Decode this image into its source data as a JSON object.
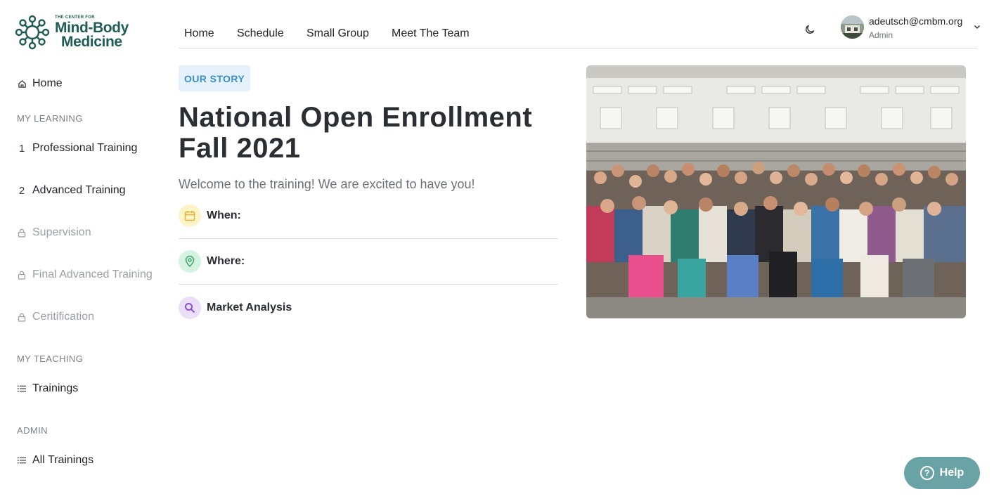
{
  "logo": {
    "tagline": "THE CENTER FOR",
    "line1": "Mind-Body",
    "line2": "Medicine",
    "brand_color": "#1f5c55"
  },
  "sidebar": {
    "home": {
      "icon": "home-icon",
      "label": "Home"
    },
    "my_learning_heading": "MY LEARNING",
    "learning_items": [
      {
        "icon_text": "1",
        "label": "Professional Training",
        "locked": false
      },
      {
        "icon_text": "2",
        "label": "Advanced Training",
        "locked": false
      },
      {
        "icon": "lock-icon",
        "label": "Supervision",
        "locked": true
      },
      {
        "icon": "lock-icon",
        "label": "Final Advanced Training",
        "locked": true
      },
      {
        "icon": "lock-icon",
        "label": "Ceritification",
        "locked": true
      }
    ],
    "my_teaching_heading": "MY TEACHING",
    "teaching_items": [
      {
        "icon": "list-icon",
        "label": "Trainings"
      }
    ],
    "admin_heading": "ADMIN",
    "admin_items": [
      {
        "icon": "list-icon",
        "label": "All Trainings"
      }
    ]
  },
  "topnav": {
    "links": [
      "Home",
      "Schedule",
      "Small Group",
      "Meet The Team"
    ],
    "theme_toggle_icon": "moon-icon",
    "user": {
      "email": "adeutsch@cmbm.org",
      "role": "Admin"
    }
  },
  "main": {
    "badge": "OUR STORY",
    "title": "National Open Enrollment Fall 2021",
    "welcome": "Welcome to the training! We are excited to have you!",
    "info_rows": [
      {
        "icon": "calendar-icon",
        "label": "When:",
        "color": "#e0b43a",
        "bg": "#fdf4c8"
      },
      {
        "icon": "map-pin-icon",
        "label": "Where:",
        "color": "#3aa56a",
        "bg": "#d6f2e1"
      },
      {
        "icon": "search-icon",
        "label": "Market Analysis",
        "color": "#8a55c9",
        "bg": "#ebdff8"
      }
    ]
  },
  "help": {
    "label": "Help",
    "icon": "question-icon",
    "color": "#6aa3a6"
  }
}
